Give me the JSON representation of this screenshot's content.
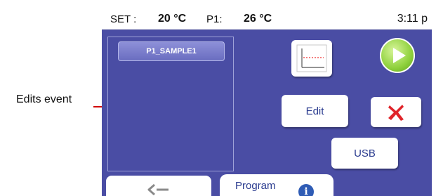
{
  "callout": {
    "label": "Edits event"
  },
  "status_bar": {
    "set_label": "SET :",
    "set_value": "20 °C",
    "p1_label": "P1:",
    "p1_value": "26 °C",
    "time": "3:11 p"
  },
  "program_list": {
    "items": [
      "P1_SAMPLE1"
    ]
  },
  "buttons": {
    "edit": "Edit",
    "usb": "USB",
    "graph_icon": "graph-icon",
    "play_icon": "play-icon",
    "cancel_icon": "close-icon"
  },
  "bottom_bar": {
    "back_icon": "back-arrow-icon",
    "program_label": "Program",
    "info_icon": "info-icon"
  },
  "colors": {
    "background": "#4a4da4",
    "accent_text": "#2a3b8f",
    "play_green": "#8fd13d",
    "cancel_red": "#e0242a",
    "callout_red": "#d10000"
  }
}
